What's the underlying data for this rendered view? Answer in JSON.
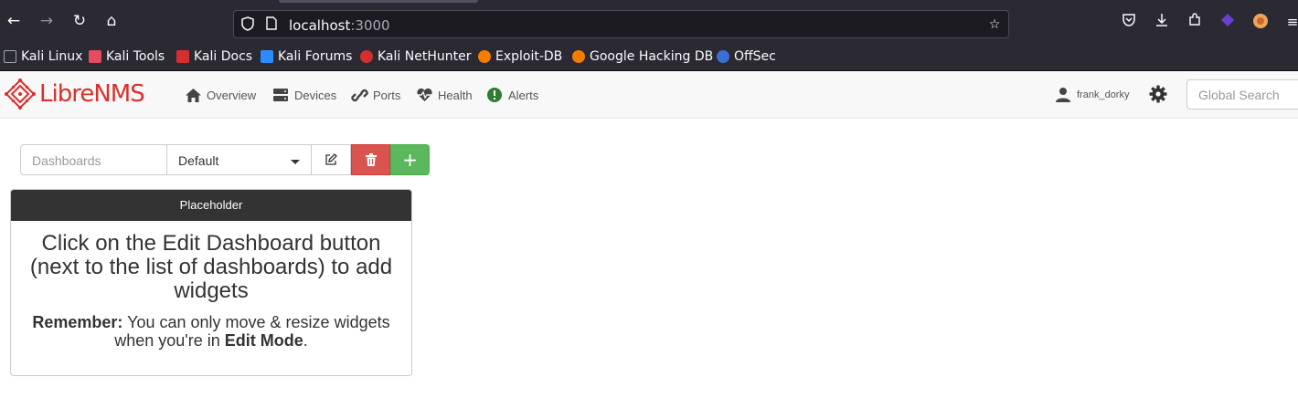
{
  "browser": {
    "url_host": "localhost",
    "url_port": ":3000",
    "bookmarks": [
      {
        "label": "Kali Linux",
        "color": "#2d8cff"
      },
      {
        "label": "Kali Tools",
        "color": "#e84a5f"
      },
      {
        "label": "Kali Docs",
        "color": "#d32f2f"
      },
      {
        "label": "Kali Forums",
        "color": "#2d8cff"
      },
      {
        "label": "Kali NetHunter",
        "color": "#d32f2f"
      },
      {
        "label": "Exploit-DB",
        "color": "#f57c00"
      },
      {
        "label": "Google Hacking DB",
        "color": "#f57c00"
      },
      {
        "label": "OffSec",
        "color": "#3b6fd6"
      }
    ]
  },
  "nav": {
    "logo_libre": "Libre",
    "logo_nms": "NMS",
    "items": [
      {
        "label": "Overview",
        "icon": "home-icon"
      },
      {
        "label": "Devices",
        "icon": "server-icon"
      },
      {
        "label": "Ports",
        "icon": "link-icon"
      },
      {
        "label": "Health",
        "icon": "heartbeat-icon"
      },
      {
        "label": "Alerts",
        "icon": "exclamation-circle-icon"
      }
    ],
    "username": "frank_dorky",
    "search_placeholder": "Global Search"
  },
  "dashboard": {
    "label_placeholder": "Dashboards",
    "selected": "Default"
  },
  "widget": {
    "title": "Placeholder",
    "message": "Click on the Edit Dashboard button (next to the list of dashboards) to add widgets",
    "remember_label": "Remember:",
    "remember_text": " You can only move & resize widgets when you're in ",
    "edit_mode": "Edit Mode",
    "end": "."
  },
  "colors": {
    "brand_red": "#d9312c",
    "danger": "#d9534f",
    "success": "#5cb85c",
    "alerts_green": "#2e7d32"
  }
}
